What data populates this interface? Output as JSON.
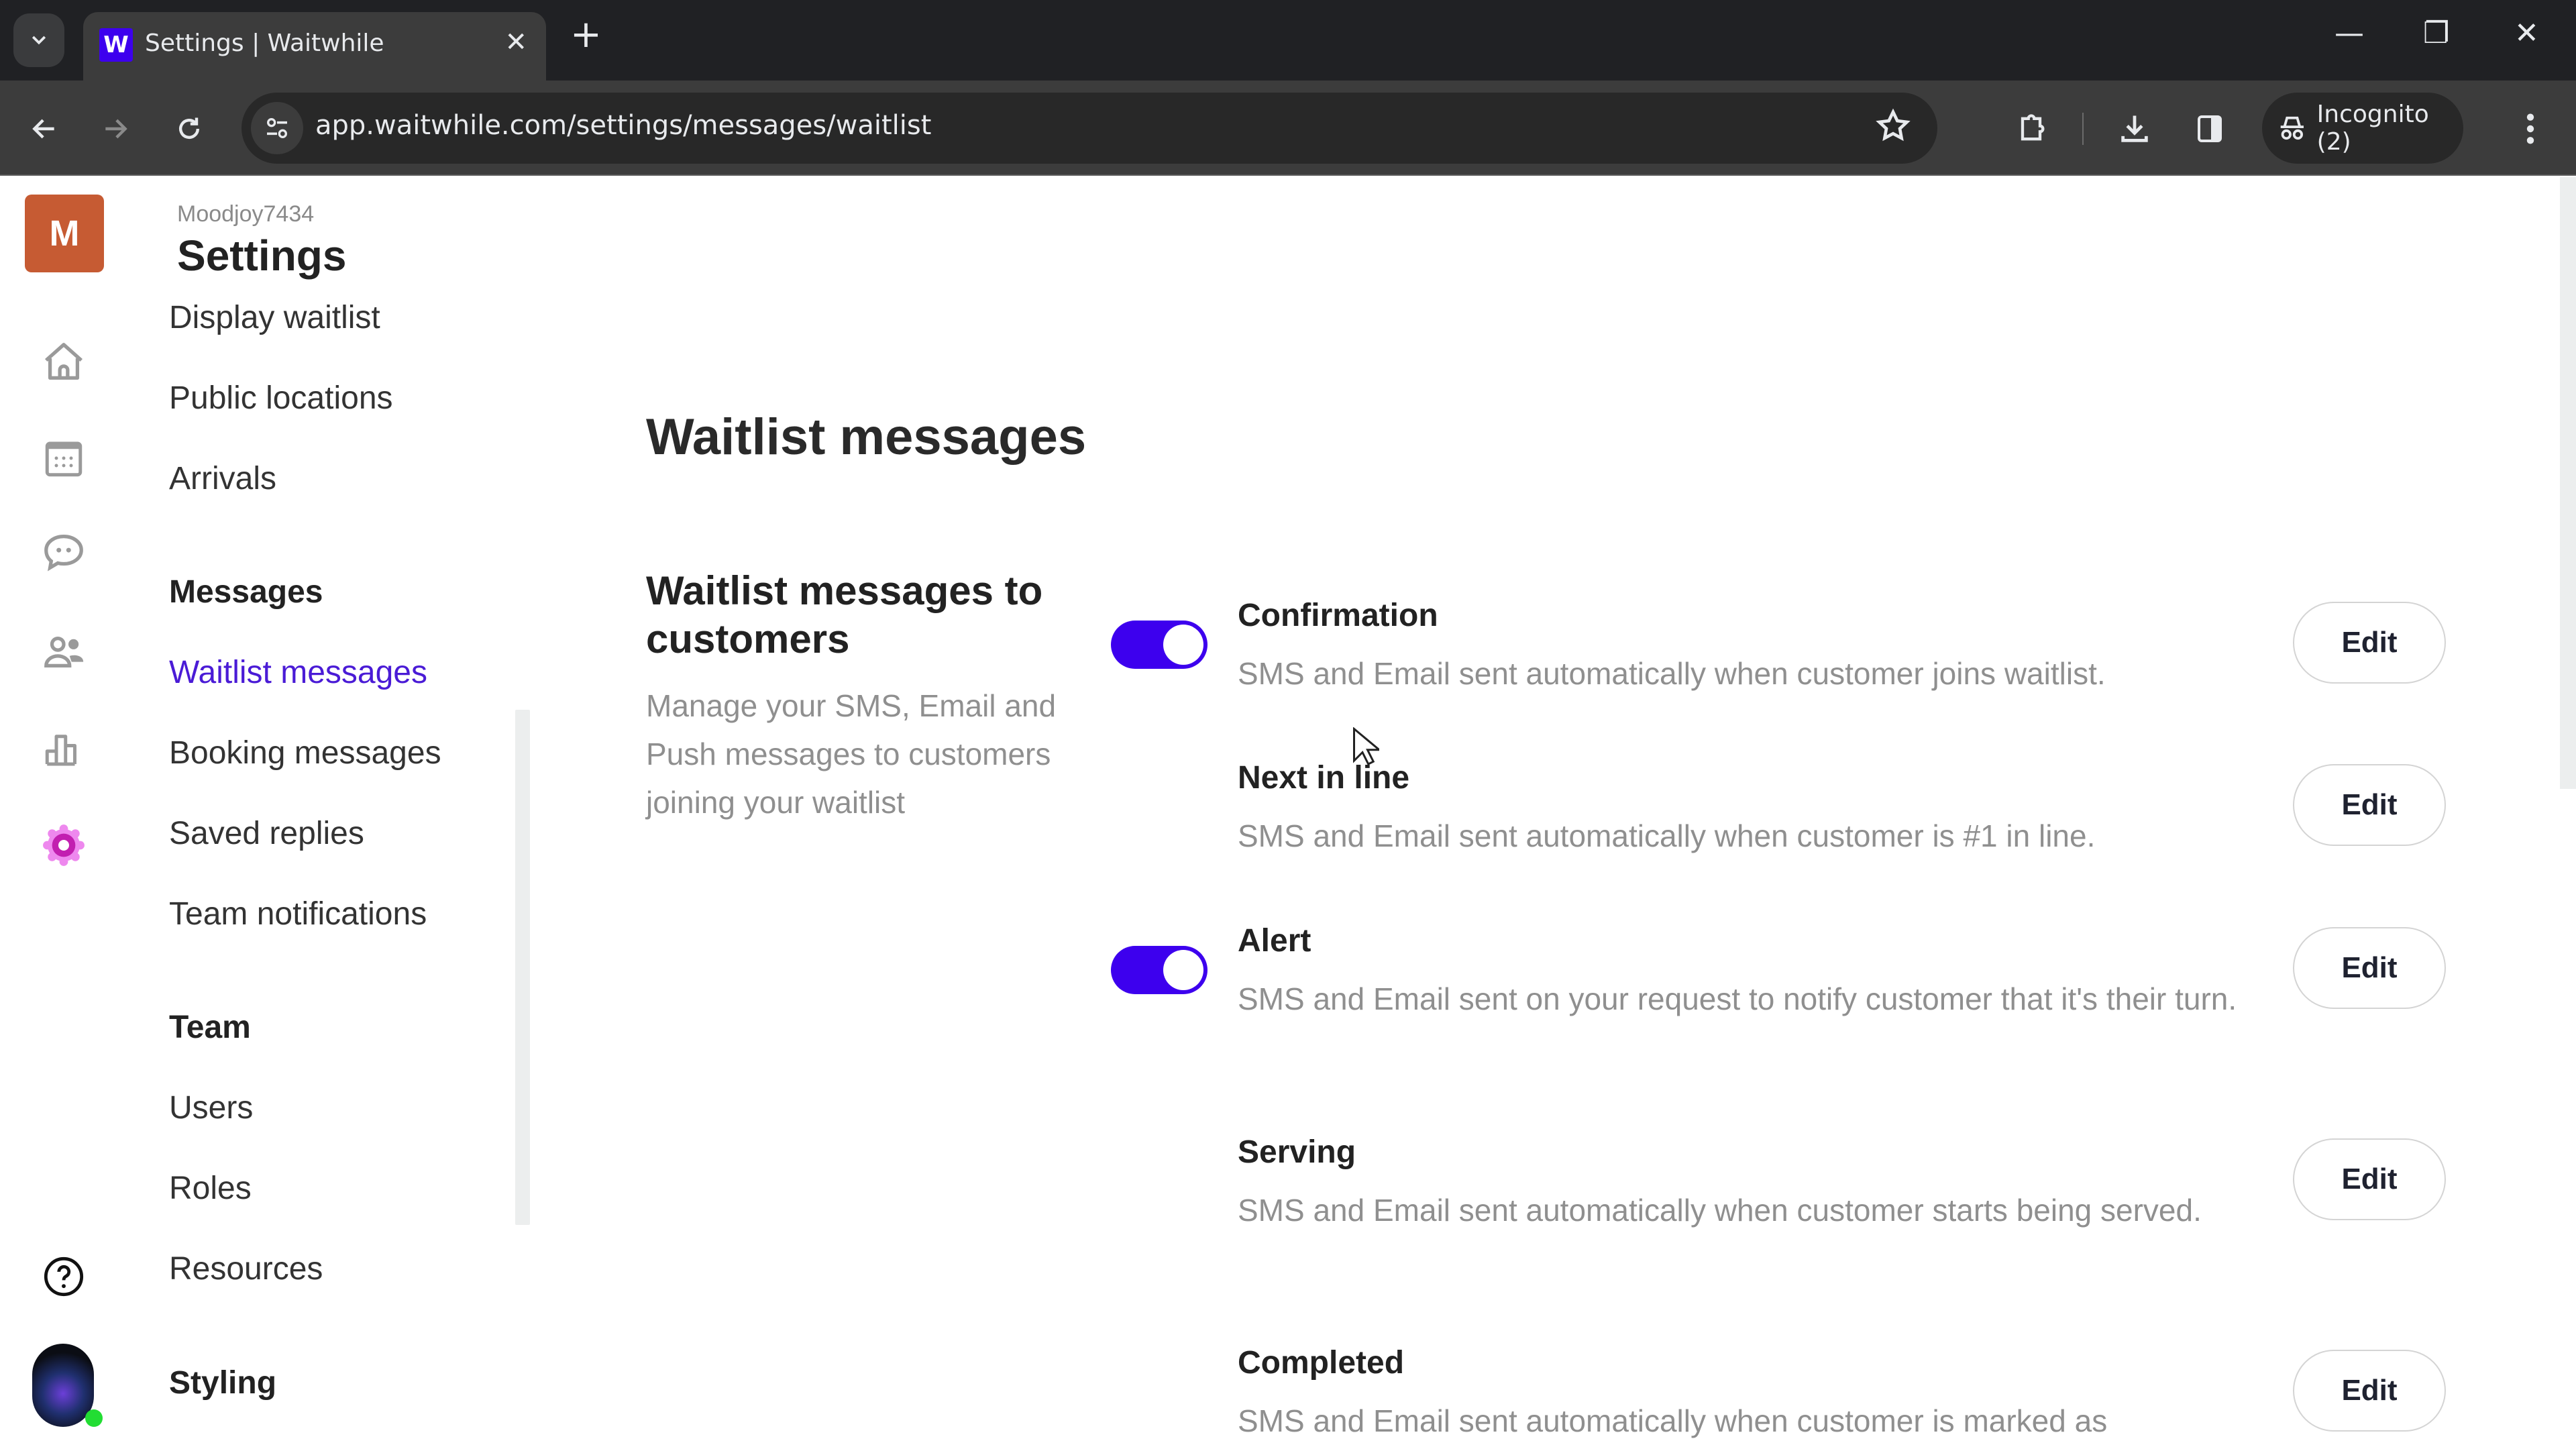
{
  "browser": {
    "tab": {
      "title": "Settings | Waitwhile",
      "favicon_letter": "W",
      "favicon_color": "#3d00ee"
    },
    "url": "app.waitwhile.com/settings/messages/waitlist",
    "incognito_label": "Incognito (2)",
    "icons": {
      "tab_search": "chevron-down-icon",
      "close_tab": "close-icon",
      "new_tab": "plus-icon",
      "back": "arrow-left-icon",
      "forward": "arrow-right-icon",
      "reload": "reload-icon",
      "site_info": "tune-icon",
      "bookmark": "star-icon",
      "extensions": "puzzle-icon",
      "downloads": "download-icon",
      "side_panel": "side-panel-icon",
      "incognito": "incognito-icon",
      "menu": "kebab-menu-icon",
      "minimize": "minimize-icon",
      "restore": "restore-icon",
      "close_window": "close-icon"
    },
    "glyphs": {
      "close": "✕",
      "plus": "+",
      "minimize": "—",
      "restore": "❐",
      "close_window": "✕"
    }
  },
  "rail": {
    "logo_letter": "M",
    "logo_color": "#c65b33",
    "items": [
      {
        "name": "home",
        "icon": "home-icon"
      },
      {
        "name": "calendar",
        "icon": "calendar-icon"
      },
      {
        "name": "messages",
        "icon": "chat-icon"
      },
      {
        "name": "customers",
        "icon": "users-icon"
      },
      {
        "name": "analytics",
        "icon": "bar-chart-icon"
      },
      {
        "name": "settings",
        "icon": "gear-icon",
        "active": true,
        "color": "#c21fb0"
      }
    ],
    "help_icon": "help-icon",
    "avatar_status": "online"
  },
  "settings_nav": {
    "org_name": "Moodjoy7434",
    "title": "Settings",
    "items_top": [
      "Display waitlist",
      "Public locations",
      "Arrivals"
    ],
    "messages_header": "Messages",
    "messages_items": [
      "Waitlist messages",
      "Booking messages",
      "Saved replies",
      "Team notifications"
    ],
    "active_item": "Waitlist messages",
    "team_header": "Team",
    "team_items": [
      "Users",
      "Roles",
      "Resources"
    ],
    "styling_header": "Styling"
  },
  "main": {
    "page_title": "Waitlist messages",
    "section": {
      "title": "Waitlist messages to customers",
      "description": "Manage your SMS, Email and Push messages to customers joining your waitlist"
    },
    "messages": [
      {
        "title": "Confirmation",
        "description": "SMS and Email sent automatically when customer joins waitlist.",
        "has_toggle": true,
        "enabled": true,
        "edit_label": "Edit"
      },
      {
        "title": "Next in line",
        "description": "SMS and Email sent automatically when customer is #1 in line.",
        "has_toggle": false,
        "edit_label": "Edit"
      },
      {
        "title": "Alert",
        "description": "SMS and Email sent on your request to notify customer that it's their turn.",
        "has_toggle": true,
        "enabled": true,
        "edit_label": "Edit"
      },
      {
        "title": "Serving",
        "description": "SMS and Email sent automatically when customer starts being served.",
        "has_toggle": false,
        "edit_label": "Edit"
      },
      {
        "title": "Completed",
        "description": "SMS and Email sent automatically when customer is marked as",
        "has_toggle": false,
        "edit_label": "Edit"
      }
    ],
    "accent_color": "#3d00ee"
  }
}
